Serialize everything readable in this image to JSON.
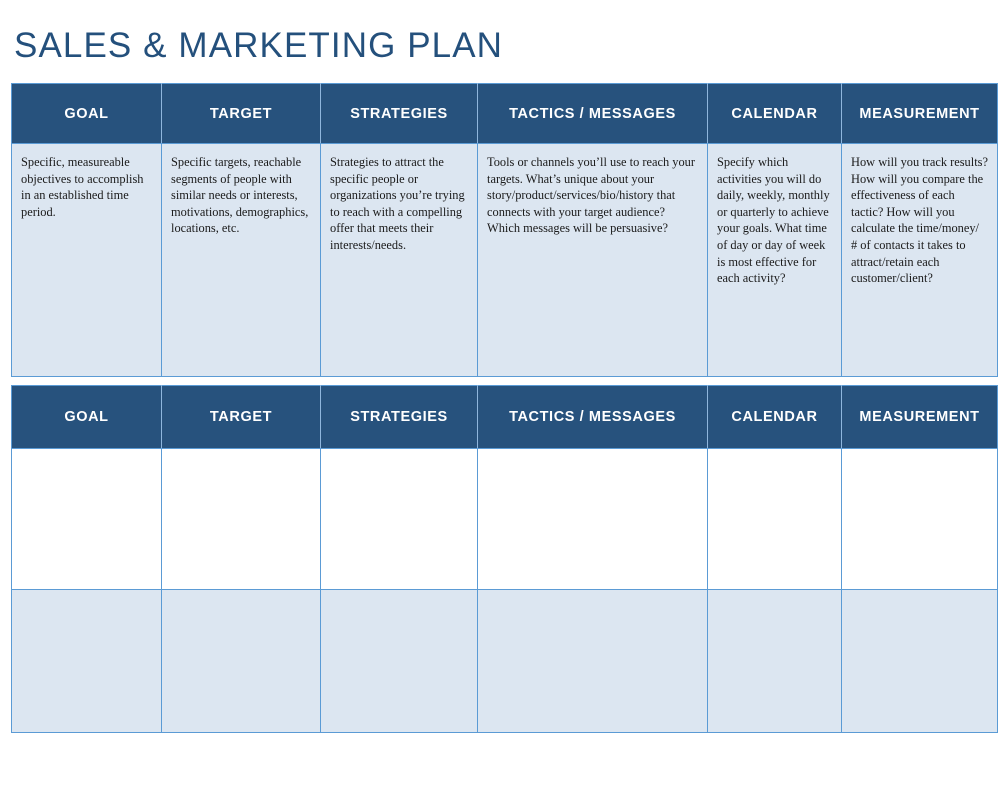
{
  "page": {
    "title": "SALES & MARKETING PLAN"
  },
  "colors": {
    "header_navy": "#27527D",
    "title_navy": "#24507C",
    "row_tint": "#DCE6F1",
    "border_blue": "#5B9BD5",
    "header_divider": "#8FB6DD",
    "body_text": "#1A1A1A",
    "header_text": "#FFFFFF"
  },
  "columns": [
    {
      "key": "goal",
      "label": "GOAL"
    },
    {
      "key": "target",
      "label": "TARGET"
    },
    {
      "key": "strategies",
      "label": "STRATEGIES"
    },
    {
      "key": "tactics",
      "label": "TACTICS / MESSAGES"
    },
    {
      "key": "calendar",
      "label": "CALENDAR"
    },
    {
      "key": "measurement",
      "label": "MEASUREMENT"
    }
  ],
  "guide_table": {
    "headers": {
      "goal": "GOAL",
      "target": "TARGET",
      "strategies": "STRATEGIES",
      "tactics": "TACTICS / MESSAGES",
      "calendar": "CALENDAR",
      "measurement": "MEASUREMENT"
    },
    "row": {
      "goal": "Specific, measureable objectives to accomplish in an established time period.",
      "target": "Specific targets, reachable segments of people with similar needs or interests, motivations, demographics, locations, etc.",
      "strategies": "Strategies to attract the specific people or organizations you’re trying to reach with a compelling offer that meets their interests/needs.",
      "tactics": "Tools or channels you’ll use to reach your targets.  What’s unique about your story/product/services/bio/history that connects with your target audience? Which messages will be persuasive?",
      "calendar": "Specify which activities you will do daily, weekly, monthly or quarterly to achieve your goals. What time of day or day of week is most effective for each activity?",
      "measurement": "How will you track results? How will you compare the effectiveness of each tactic? How will you calculate the time/money/ # of contacts it takes to attract/retain each customer/client?"
    }
  },
  "blank_table": {
    "headers": {
      "goal": "GOAL",
      "target": "TARGET",
      "strategies": "STRATEGIES",
      "tactics": "TACTICS / MESSAGES",
      "calendar": "CALENDAR",
      "measurement": "MEASUREMENT"
    },
    "rows": [
      {
        "goal": "",
        "target": "",
        "strategies": "",
        "tactics": "",
        "calendar": "",
        "measurement": ""
      },
      {
        "goal": "",
        "target": "",
        "strategies": "",
        "tactics": "",
        "calendar": "",
        "measurement": ""
      }
    ]
  }
}
